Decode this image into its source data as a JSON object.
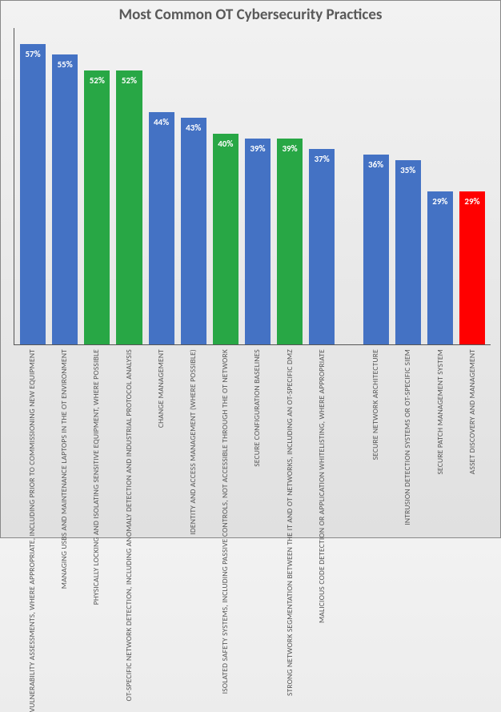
{
  "chart_data": {
    "type": "bar",
    "title": "Most Common OT Cybersecurity Practices",
    "ylabel": "",
    "xlabel": "",
    "ylim": [
      0,
      60
    ],
    "bars": [
      {
        "label": "VULNERABILITY ASSESSMENTS, WHERE APPROPRIATE, INCLUDING PRIOR TO COMMISSIONING NEW EQUIPMENT",
        "value": 57,
        "color": "blue"
      },
      {
        "label": "MANAGING USBS AND MAINTENANCE LAPTOPS IN THE OT ENVIRONMENT",
        "value": 55,
        "color": "blue"
      },
      {
        "label": "PHYSICALLY LOCKING AND ISOLATING SENSITIVE EQUIPMENT, WHERE POSSIBLE",
        "value": 52,
        "color": "green"
      },
      {
        "label": "OT-SPECIFIC NETWORK DETECTION, INCLUDING ANOMALY DETECTION AND INDUSTRIAL PROTOCOL ANALYSIS",
        "value": 52,
        "color": "green"
      },
      {
        "label": "CHANGE MANAGEMENT",
        "value": 44,
        "color": "blue"
      },
      {
        "label": "IDENTITY AND ACCESS MANAGEMENT (WHERE POSSIBLE)",
        "value": 43,
        "color": "blue"
      },
      {
        "label": "ISOLATED SAFETY SYSTEMS, INCLUDING PASSIVE CONTROLS, NOT ACCESSIBLE THROUGH THE OT NETWORK",
        "value": 40,
        "color": "green"
      },
      {
        "label": "SECURE CONFIGURATION BASELINES",
        "value": 39,
        "color": "blue"
      },
      {
        "label": "STRONG NETWORK SEGMENTATION BETWEEN THE IT AND OT NETWORKS, INCLUDING AN OT-SPECIFIC DMZ",
        "value": 39,
        "color": "green"
      },
      {
        "label": "MALICIOUS CODE DETECTION OR APPLICATION WHITELISTING, WHERE APPROPRIATE",
        "value": 37,
        "color": "blue"
      },
      {
        "gap": true
      },
      {
        "label": "SECURE NETWORK ARCHITECTURE",
        "value": 36,
        "color": "blue"
      },
      {
        "label": "INTRUSION DETECTION SYSTEMS OR OT-SPECIFIC SIEM",
        "value": 35,
        "color": "blue"
      },
      {
        "label": "SECURE PATCH MANAGEMENT SYSTEM",
        "value": 29,
        "color": "blue"
      },
      {
        "label": "ASSET DISCOVERY AND MANAGEMENT",
        "value": 29,
        "color": "red"
      }
    ]
  }
}
